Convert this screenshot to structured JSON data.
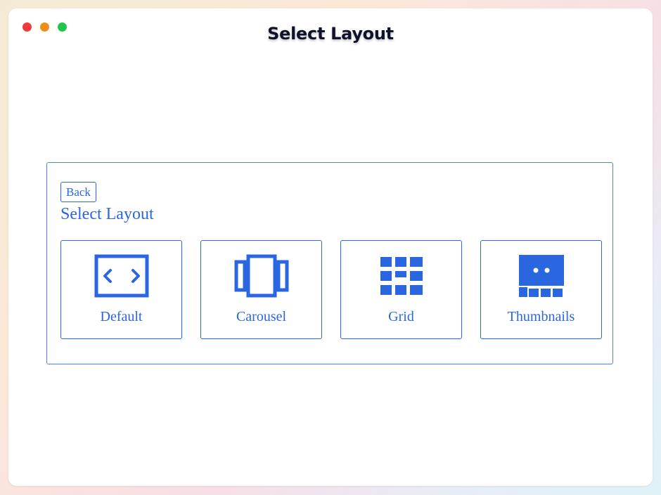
{
  "window": {
    "title": "Select Layout"
  },
  "panel": {
    "back_label": "Back",
    "heading": "Select Layout"
  },
  "layouts": [
    {
      "label": "Default",
      "icon": "default-layout-icon"
    },
    {
      "label": "Carousel",
      "icon": "carousel-layout-icon"
    },
    {
      "label": "Grid",
      "icon": "grid-layout-icon"
    },
    {
      "label": "Thumbnails",
      "icon": "thumbnails-layout-icon"
    }
  ],
  "colors": {
    "accent": "#2a66e0",
    "title": "#10112a",
    "close": "#ef3b3b",
    "minimize": "#f08c1a",
    "maximize": "#22c44d"
  }
}
